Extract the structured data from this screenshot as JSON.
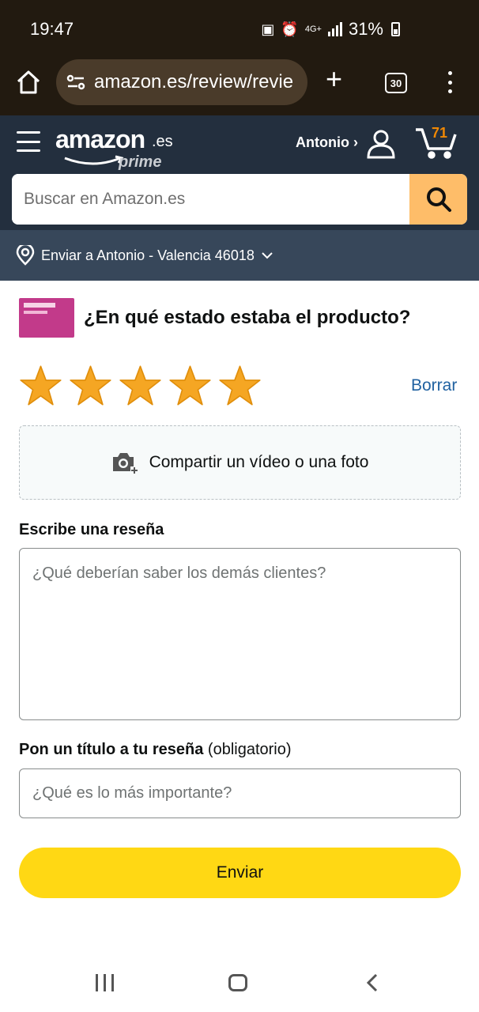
{
  "status_bar": {
    "time": "19:47",
    "network": "4G+",
    "battery": "31%"
  },
  "browser": {
    "url": "amazon.es/review/revie",
    "tabs_count": "30"
  },
  "header": {
    "logo_text": "amazon",
    "logo_domain": ".es",
    "logo_sub": "prime",
    "account_name": "Antonio ›",
    "cart_count": "71",
    "search_placeholder": "Buscar en Amazon.es"
  },
  "delivery": {
    "text": "Enviar a Antonio - Valencia 46018"
  },
  "product": {
    "question": "¿En qué estado estaba el producto?",
    "thumb_text": "LACTOFEM"
  },
  "rating": {
    "stars": 5,
    "clear_label": "Borrar"
  },
  "media": {
    "label": "Compartir un vídeo o una foto"
  },
  "review": {
    "label": "Escribe una reseña",
    "placeholder": "¿Qué deberían saber los demás clientes?"
  },
  "title": {
    "label": "Pon un título a tu reseña",
    "label_suffix": "(obligatorio)",
    "placeholder": "¿Qué es lo más importante?"
  },
  "submit": {
    "label": "Enviar"
  },
  "colors": {
    "header_bg": "#232f3e",
    "deliver_bg": "#37475a",
    "search_btn": "#febd69",
    "star": "#f5a623",
    "submit": "#ffd814",
    "link": "#2162a1"
  }
}
